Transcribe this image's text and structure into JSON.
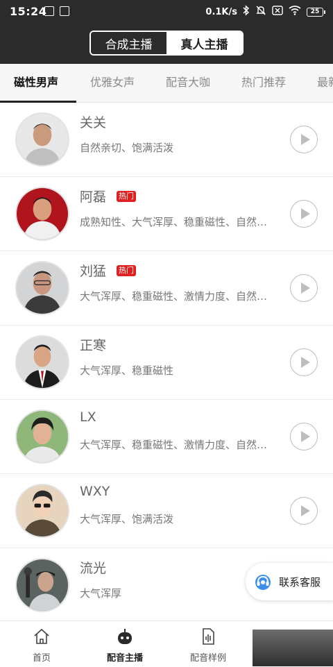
{
  "status_bar": {
    "time": "15:24",
    "network_speed": "0.1K/s",
    "battery": "25",
    "icons": [
      "notification-icon",
      "notification-icon",
      "bluetooth-icon",
      "mute-bell-icon",
      "sim-off-icon",
      "wifi-icon",
      "battery-icon"
    ]
  },
  "segmented": {
    "options": [
      "合成主播",
      "真人主播"
    ],
    "selected": "合成主播"
  },
  "tabs": {
    "items": [
      "磁性男声",
      "优雅女声",
      "配音大咖",
      "热门推荐",
      "最新"
    ],
    "selected": "磁性男声"
  },
  "voices": [
    {
      "name": "关关",
      "hot": false,
      "tags": "自然亲切、饱满活泼"
    },
    {
      "name": "阿磊",
      "hot": true,
      "tags": "成熟知性、大气浑厚、稳重磁性、自然亲切"
    },
    {
      "name": "刘猛",
      "hot": true,
      "tags": "大气浑厚、稳重磁性、激情力度、自然亲切"
    },
    {
      "name": "正寒",
      "hot": false,
      "tags": "大气浑厚、稳重磁性"
    },
    {
      "name": "LX",
      "hot": false,
      "tags": "大气浑厚、稳重磁性、激情力度、自然亲切"
    },
    {
      "name": "WXY",
      "hot": false,
      "tags": "大气浑厚、饱满活泼"
    },
    {
      "name": "流光",
      "hot": false,
      "tags": "大气浑厚"
    }
  ],
  "hot_badge": "热门",
  "service": {
    "label": "联系客服",
    "icon": "headset-icon"
  },
  "bottom_nav": {
    "items": [
      {
        "label": "首页",
        "icon": "home-icon"
      },
      {
        "label": "配音主播",
        "icon": "robot-icon"
      },
      {
        "label": "配音样例",
        "icon": "audio-file-icon"
      }
    ],
    "selected": "配音主播"
  },
  "colors": {
    "header_bg": "#2b2b2b",
    "hot_badge": "#e02020",
    "tab_bar_bg": "#f6f6f6"
  }
}
